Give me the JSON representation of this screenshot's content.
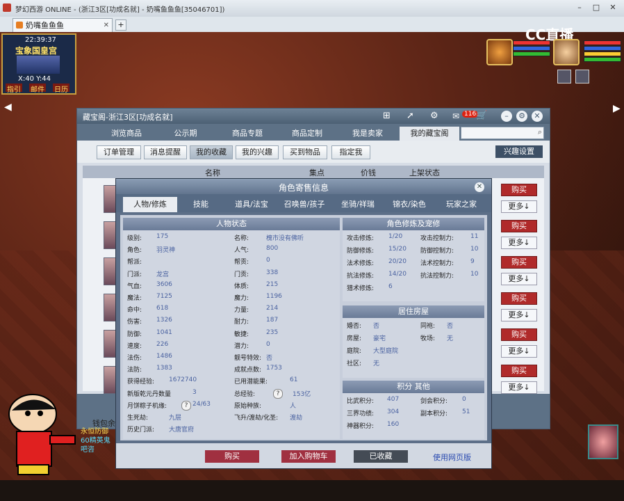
{
  "browser": {
    "title": "梦幻西游 ONLINE - (浙江3区[功成名就] - 奶嘴鱼鱼鱼[35046701])",
    "tab_label": "奶嘴鱼鱼鱼",
    "watermark": "CC直播"
  },
  "hud": {
    "time": "22:39:37",
    "location": "宝象国皇宫",
    "coords": "X:40  Y:44",
    "buttons": [
      "指引",
      "邮件",
      "日历"
    ]
  },
  "window": {
    "title": "藏宝阁-浙江3区[功成名就]",
    "cart_count": "116",
    "nav_tabs": [
      "浏览商品",
      "公示期",
      "商品专题",
      "商品定制",
      "我是卖家",
      "我的藏宝阁"
    ],
    "active_nav_tab": "我的藏宝阁",
    "sub_tabs": [
      "订单管理",
      "消息提醒",
      "我的收藏",
      "我的兴趣",
      "买到物品",
      "指定我"
    ],
    "active_sub_tab": "我的收藏",
    "interest_button": "兴趣设置",
    "list_headers": [
      "名称",
      "集点",
      "价钱",
      "上架状态"
    ],
    "buy_label": "购买",
    "more_label": "更多↓",
    "wallet_label": "钱包余",
    "chat_lines": [
      "永恒防御",
      "60精英鬼",
      "吧咨"
    ]
  },
  "dialog": {
    "title": "角色寄售信息",
    "tabs": [
      "人物/修炼",
      "技能",
      "道具/法宝",
      "召唤兽/孩子",
      "坐骑/祥瑞",
      "锦衣/染色",
      "玩家之家"
    ],
    "active_tab": "人物/修炼",
    "status_title": "人物状态",
    "status_left": [
      {
        "label": "级别:",
        "value": "175"
      },
      {
        "label": "角色:",
        "value": "羽灵神"
      },
      {
        "label": "帮派:",
        "value": ""
      },
      {
        "label": "门派:",
        "value": "龙宫"
      },
      {
        "label": "气血:",
        "value": "3606"
      },
      {
        "label": "魔法:",
        "value": "7125"
      },
      {
        "label": "命中:",
        "value": "618"
      },
      {
        "label": "伤害:",
        "value": "1326"
      },
      {
        "label": "防御:",
        "value": "1041"
      },
      {
        "label": "速度:",
        "value": "226"
      },
      {
        "label": "法伤:",
        "value": "1486"
      },
      {
        "label": "法防:",
        "value": "1383"
      }
    ],
    "status_right": [
      {
        "label": "名称:",
        "value": "槐市没有佛听"
      },
      {
        "label": "人气:",
        "value": "800"
      },
      {
        "label": "帮贡:",
        "value": "0"
      },
      {
        "label": "门贡:",
        "value": "338"
      },
      {
        "label": "体质:",
        "value": "215"
      },
      {
        "label": "魔力:",
        "value": "1196"
      },
      {
        "label": "力量:",
        "value": "214"
      },
      {
        "label": "耐力:",
        "value": "187"
      },
      {
        "label": "敏捷:",
        "value": "235"
      },
      {
        "label": "潜力:",
        "value": "0"
      },
      {
        "label": "靓号特效:",
        "value": "否"
      },
      {
        "label": "成就点数:",
        "value": "1753"
      }
    ],
    "status_bottom": [
      {
        "label": "获得经验:",
        "value": "1672740",
        "label2": "已用潜能果:",
        "value2": "61"
      },
      {
        "label": "新版乾元丹数量",
        "value": "3",
        "label2": "总经验:",
        "value2": "153亿"
      },
      {
        "label": "月饼粽子机缘:",
        "value": "24/63",
        "label2": "原始种族:",
        "value2": "人"
      },
      {
        "label": "生死劫:",
        "value": "九层",
        "label2": "飞升/渡劫/化圣:",
        "value2": "渡劫"
      },
      {
        "label": "历史门派:",
        "value": "大唐官府",
        "label2": "",
        "value2": ""
      }
    ],
    "cultivation_title": "角色修炼及宠修",
    "cultivation": [
      {
        "label": "攻击修炼:",
        "value": "1/20",
        "label2": "攻击控制力:",
        "value2": "11"
      },
      {
        "label": "防御修炼:",
        "value": "15/20",
        "label2": "防御控制力:",
        "value2": "10"
      },
      {
        "label": "法术修炼:",
        "value": "20/20",
        "label2": "法术控制力:",
        "value2": "9"
      },
      {
        "label": "抗法修炼:",
        "value": "14/20",
        "label2": "抗法控制力:",
        "value2": "10"
      },
      {
        "label": "猎术修炼:",
        "value": "6",
        "label2": "",
        "value2": ""
      }
    ],
    "house_title": "居住房屋",
    "house": [
      {
        "label": "婚否:",
        "value": "否",
        "label2": "同袍:",
        "value2": "否"
      },
      {
        "label": "房屋:",
        "value": "豪宅",
        "label2": "牧场:",
        "value2": "无"
      },
      {
        "label": "庭院:",
        "value": "大型庭院",
        "label2": "",
        "value2": ""
      },
      {
        "label": "社区:",
        "value": "无",
        "label2": "",
        "value2": ""
      }
    ],
    "score_title": "积分 其他",
    "score": [
      {
        "label": "比武积分:",
        "value": "407",
        "label2": "剑会积分:",
        "value2": "0"
      },
      {
        "label": "三界功绩:",
        "value": "304",
        "label2": "副本积分:",
        "value2": "51"
      },
      {
        "label": "神器积分:",
        "value": "160",
        "label2": "",
        "value2": ""
      }
    ],
    "buttons": {
      "buy": "购买",
      "add_cart": "加入购物车",
      "collected": "已收藏",
      "web_version": "使用网页版"
    }
  },
  "colors": {
    "accent_red": "#b02a2a",
    "header_blue": "#5d7186",
    "value_blue": "#4a62a0"
  }
}
